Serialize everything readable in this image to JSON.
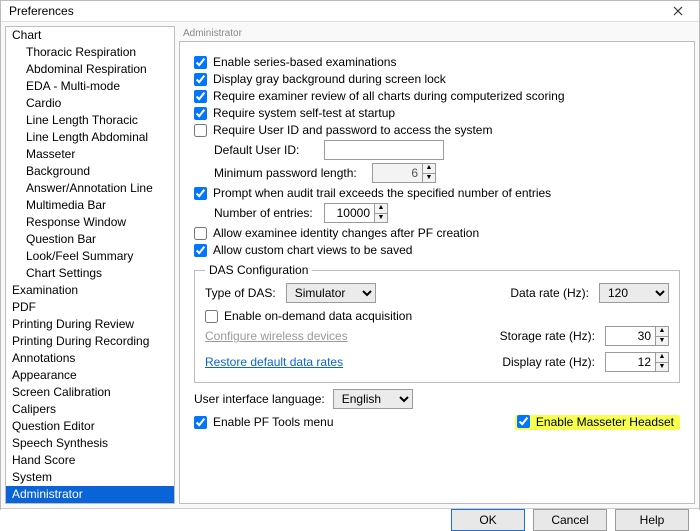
{
  "window": {
    "title": "Preferences"
  },
  "sidebar": {
    "items": [
      {
        "label": "Chart",
        "indent": false
      },
      {
        "label": "Thoracic Respiration",
        "indent": true
      },
      {
        "label": "Abdominal Respiration",
        "indent": true
      },
      {
        "label": "EDA - Multi-mode",
        "indent": true
      },
      {
        "label": "Cardio",
        "indent": true
      },
      {
        "label": "Line Length Thoracic",
        "indent": true
      },
      {
        "label": "Line Length Abdominal",
        "indent": true
      },
      {
        "label": "Masseter",
        "indent": true
      },
      {
        "label": "Background",
        "indent": true
      },
      {
        "label": "Answer/Annotation Line",
        "indent": true
      },
      {
        "label": "Multimedia Bar",
        "indent": true
      },
      {
        "label": "Response Window",
        "indent": true
      },
      {
        "label": "Question Bar",
        "indent": true
      },
      {
        "label": "Look/Feel Summary",
        "indent": true
      },
      {
        "label": "Chart Settings",
        "indent": true
      },
      {
        "label": "Examination",
        "indent": false
      },
      {
        "label": "PDF",
        "indent": false
      },
      {
        "label": "Printing During Review",
        "indent": false
      },
      {
        "label": "Printing During Recording",
        "indent": false
      },
      {
        "label": "Annotations",
        "indent": false
      },
      {
        "label": "Appearance",
        "indent": false
      },
      {
        "label": "Screen Calibration",
        "indent": false
      },
      {
        "label": "Calipers",
        "indent": false
      },
      {
        "label": "Question Editor",
        "indent": false
      },
      {
        "label": "Speech Synthesis",
        "indent": false
      },
      {
        "label": "Hand Score",
        "indent": false
      },
      {
        "label": "System",
        "indent": false
      },
      {
        "label": "Administrator",
        "indent": false,
        "selected": true
      }
    ]
  },
  "panel": {
    "caption": "Administrator",
    "cb_series": "Enable series-based examinations",
    "cb_gray": "Display gray background during screen lock",
    "cb_examiner": "Require examiner review of all charts during computerized scoring",
    "cb_selftest": "Require system self-test at startup",
    "cb_userid": "Require User ID and password to access the system",
    "lbl_default_userid": "Default User ID:",
    "val_default_userid": "",
    "lbl_min_pw": "Minimum password length:",
    "val_min_pw": "6",
    "cb_audit": "Prompt when audit trail exceeds the specified number of entries",
    "lbl_num_entries": "Number of entries:",
    "val_num_entries": "10000",
    "cb_identity": "Allow examinee identity changes after PF creation",
    "cb_customviews": "Allow custom chart views to be saved",
    "das": {
      "legend": "DAS Configuration",
      "lbl_type": "Type of DAS:",
      "val_type": "Simulator",
      "lbl_datarate": "Data rate (Hz):",
      "val_datarate": "120",
      "cb_ondemand": "Enable on-demand data acquisition",
      "link_wireless": "Configure wireless devices",
      "link_restore": "Restore default data rates",
      "lbl_storage": "Storage rate (Hz):",
      "val_storage": "30",
      "lbl_display": "Display rate (Hz):",
      "val_display": "12"
    },
    "lbl_lang": "User interface language:",
    "val_lang": "English",
    "cb_pftools": "Enable PF Tools menu",
    "cb_masseter": "Enable Masseter Headset"
  },
  "footer": {
    "ok": "OK",
    "cancel": "Cancel",
    "help": "Help"
  }
}
